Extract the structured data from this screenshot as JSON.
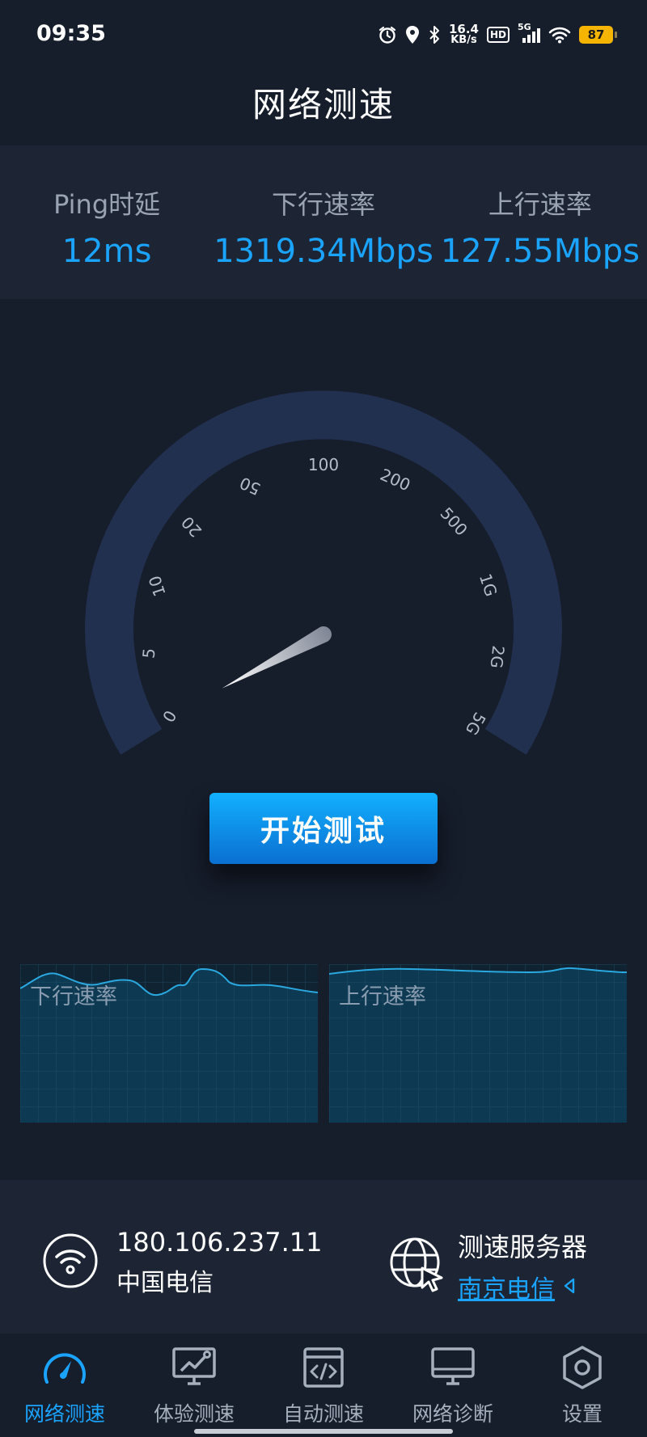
{
  "status_bar": {
    "time": "09:35",
    "net_speed_value": "16.4",
    "net_speed_unit": "KB/s",
    "hd": "HD",
    "signal": "5G",
    "battery": "87"
  },
  "page_title": "网络测速",
  "metrics": [
    {
      "label": "Ping时延",
      "value": "12ms"
    },
    {
      "label": "下行速率",
      "value": "1319.34Mbps"
    },
    {
      "label": "上行速率",
      "value": "127.55Mbps"
    }
  ],
  "gauge": {
    "ticks": [
      "0",
      "5",
      "10",
      "20",
      "50",
      "100",
      "200",
      "500",
      "1G",
      "2G",
      "5G"
    ]
  },
  "start_button": "开始测试",
  "charts": {
    "download_label": "下行速率",
    "upload_label": "上行速率"
  },
  "connection": {
    "ip": "180.106.237.11",
    "isp": "中国电信"
  },
  "server": {
    "title": "测速服务器",
    "name": "南京电信"
  },
  "tabs": [
    {
      "label": "网络测速",
      "active": true
    },
    {
      "label": "体验测速",
      "active": false
    },
    {
      "label": "自动测速",
      "active": false
    },
    {
      "label": "网络诊断",
      "active": false
    },
    {
      "label": "设置",
      "active": false
    }
  ],
  "colors": {
    "accent": "#1aa3ff",
    "background": "#161d2b",
    "panel": "#1d2534",
    "gauge_ring": "#22304f",
    "chart_fill": "#0d3a52",
    "chart_line": "#2aa8e0"
  }
}
